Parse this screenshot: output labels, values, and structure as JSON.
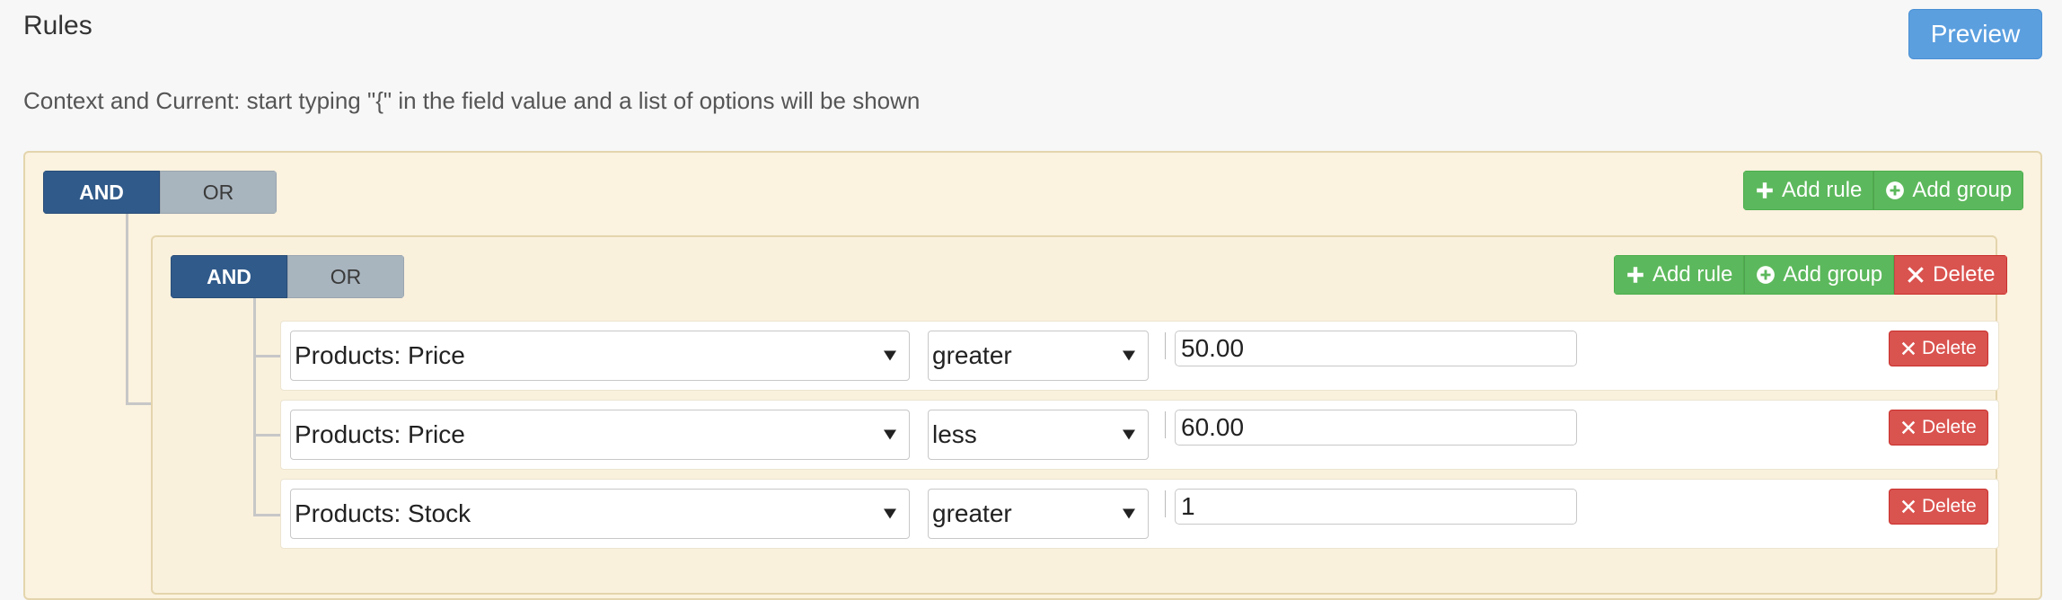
{
  "header": {
    "title": "Rules",
    "preview_label": "Preview",
    "hint": "Context and Current: start typing \"{\" in the field value and a list of options will be shown"
  },
  "outer_group": {
    "condition_and": "AND",
    "condition_or": "OR",
    "add_rule_label": "Add rule",
    "add_group_label": "Add group"
  },
  "inner_group": {
    "condition_and": "AND",
    "condition_or": "OR",
    "add_rule_label": "Add rule",
    "add_group_label": "Add group",
    "delete_label": "Delete",
    "rules": [
      {
        "field": "Products: Price",
        "operator": "greater",
        "value": "50.00",
        "delete_label": "Delete"
      },
      {
        "field": "Products: Price",
        "operator": "less",
        "value": "60.00",
        "delete_label": "Delete"
      },
      {
        "field": "Products: Stock",
        "operator": "greater",
        "value": "1",
        "delete_label": "Delete"
      }
    ]
  },
  "colors": {
    "primary": "#305a8a",
    "success": "#5cb85c",
    "danger": "#d9534f",
    "preview": "#5b9fdf",
    "group_bg": "#fbf2df"
  },
  "icons": {
    "add_rule": "plus-icon",
    "add_group": "plus-circle-icon",
    "delete": "x-icon"
  }
}
